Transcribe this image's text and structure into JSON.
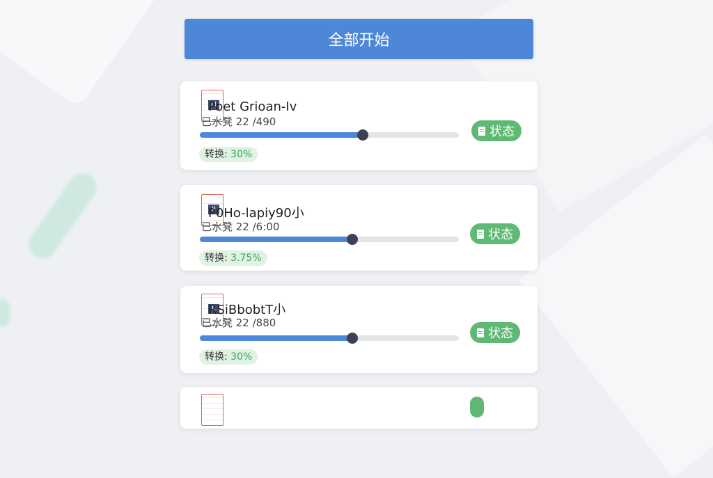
{
  "header": {
    "start_all_label": "全部开始"
  },
  "tasks": [
    {
      "title": "Poet Grioan-Iv",
      "meta": "已水凳 22 /490",
      "convert_label": "转换:",
      "convert_pct": "30%",
      "progress": 0.63,
      "status_label": "状态",
      "thumb_badge": "Tl"
    },
    {
      "title": "P0Ho-lapiy90小",
      "meta": "已水凳 22 /6:00",
      "convert_label": "转换:",
      "convert_pct": "3.75%",
      "progress": 0.59,
      "status_label": "状态",
      "thumb_badge": "H"
    },
    {
      "title": "RSiBbobtT小",
      "meta": "已水凳 22 /880",
      "convert_label": "转换:",
      "convert_pct": "30%",
      "progress": 0.59,
      "status_label": "状态",
      "thumb_badge": "R"
    },
    {
      "title": "",
      "meta": "",
      "convert_label": "",
      "convert_pct": "",
      "progress": 0,
      "status_label": "",
      "thumb_badge": ""
    }
  ],
  "colors": {
    "accent": "#4f87d8",
    "status": "#5fb874",
    "knob": "#3b4255"
  },
  "icons": {
    "status": "document-icon"
  }
}
